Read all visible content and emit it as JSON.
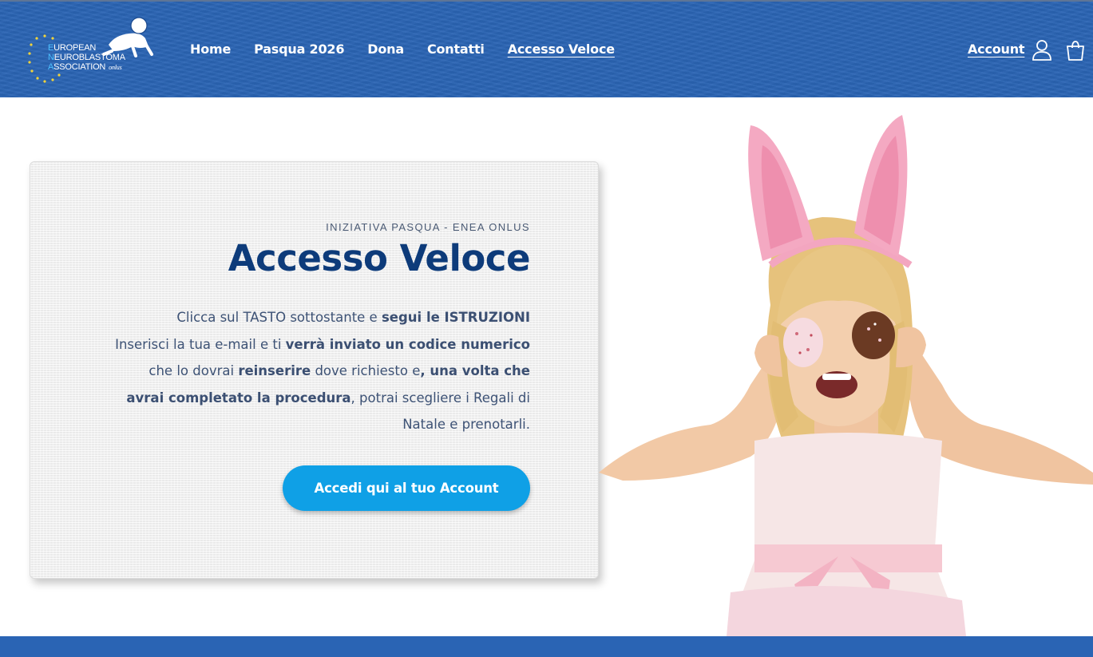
{
  "header": {
    "logo": {
      "line1": {
        "cap": "E",
        "rest": "UROPEAN"
      },
      "line2": {
        "cap": "N",
        "rest": "EUROBLASTOMA"
      },
      "line3": {
        "cap": "A",
        "rest": "SSOCIATION",
        "suffix": "onlus"
      }
    },
    "nav": [
      {
        "label": "Home"
      },
      {
        "label": "Pasqua 2026"
      },
      {
        "label": "Dona"
      },
      {
        "label": "Contatti"
      },
      {
        "label": "Accesso Veloce",
        "active": true
      }
    ],
    "account_label": "Account",
    "icons": {
      "user": "user-icon",
      "cart": "cart-icon"
    },
    "color": "#2a64b4"
  },
  "card": {
    "eyebrow": "INIZIATIVA PASQUA - ENEA ONLUS",
    "title": "Accesso Veloce",
    "desc": {
      "l1a": "Clicca sul TASTO sottostante e ",
      "l1b": "segui le ISTRUZIONI",
      "l2a": "Inserisci la tua e-mail e ti ",
      "l2b": "verrà inviato un codice numerico",
      "l3a": "che lo dovrai ",
      "l3b": "reinserire",
      "l3c": " dove richiesto e",
      "l3d": ", una volta che",
      "l4a": "avrai completato la procedura",
      "l4b": ", potrai scegliere i Regali di",
      "l5": "Natale e prenotarli."
    },
    "cta_label": "Accedi qui al tuo Account",
    "cta_color": "#0fa0e6",
    "title_color": "#0d3b7a"
  },
  "hero": {
    "alt": "Bambina con orecchie da coniglio e uova di Pasqua"
  }
}
